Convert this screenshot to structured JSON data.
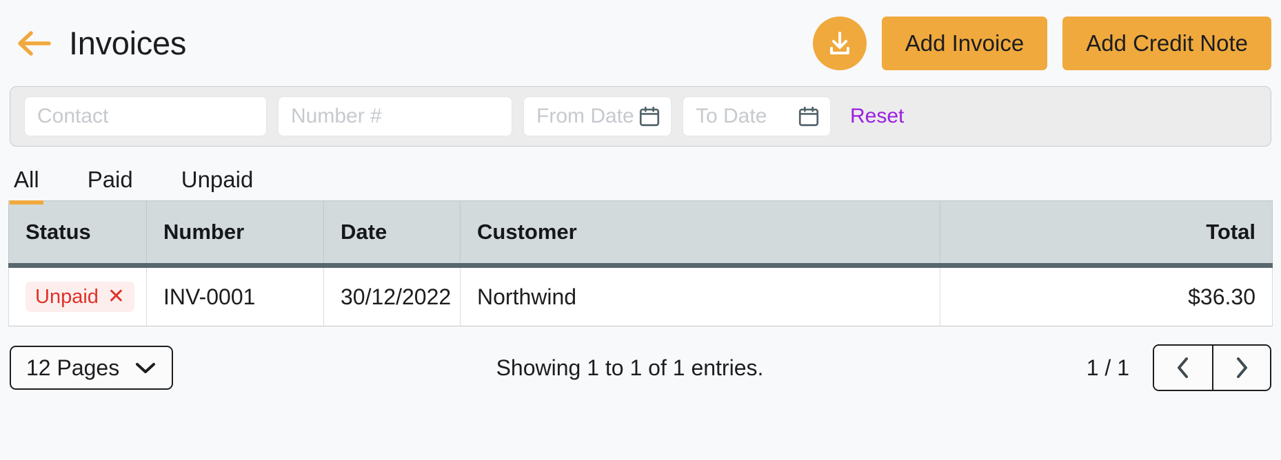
{
  "header": {
    "back_icon": "arrow-left-icon",
    "title": "Invoices",
    "download_icon": "download-icon",
    "add_invoice_label": "Add Invoice",
    "add_credit_note_label": "Add Credit Note",
    "accent_color": "#f0a93d"
  },
  "filters": {
    "contact_placeholder": "Contact",
    "contact_value": "",
    "number_placeholder": "Number #",
    "number_value": "",
    "from_date_placeholder": "From Date",
    "from_date_value": "",
    "to_date_placeholder": "To Date",
    "to_date_value": "",
    "calendar_icon": "calendar-icon",
    "reset_label": "Reset",
    "reset_color": "#9b21e0"
  },
  "tabs": [
    {
      "label": "All",
      "active": true
    },
    {
      "label": "Paid",
      "active": false
    },
    {
      "label": "Unpaid",
      "active": false
    }
  ],
  "table": {
    "columns": [
      {
        "label": "Status",
        "align": "left"
      },
      {
        "label": "Number",
        "align": "left"
      },
      {
        "label": "Date",
        "align": "left"
      },
      {
        "label": "Customer",
        "align": "left"
      },
      {
        "label": "",
        "align": "left"
      },
      {
        "label": "Total",
        "align": "right"
      }
    ],
    "rows": [
      {
        "status": "Unpaid",
        "status_color": "#e03127",
        "status_bg": "#fdeeee",
        "status_dismiss_icon": "close-icon",
        "number": "INV-0001",
        "date": "30/12/2022",
        "customer": "Northwind",
        "blank": "",
        "total": "$36.30"
      }
    ]
  },
  "footer": {
    "pages_label": "12 Pages",
    "pages_chevron_icon": "chevron-down-icon",
    "showing_text": "Showing 1 to 1 of 1 entries.",
    "page_indicator": "1 / 1",
    "prev_icon": "chevron-left-icon",
    "next_icon": "chevron-right-icon"
  }
}
